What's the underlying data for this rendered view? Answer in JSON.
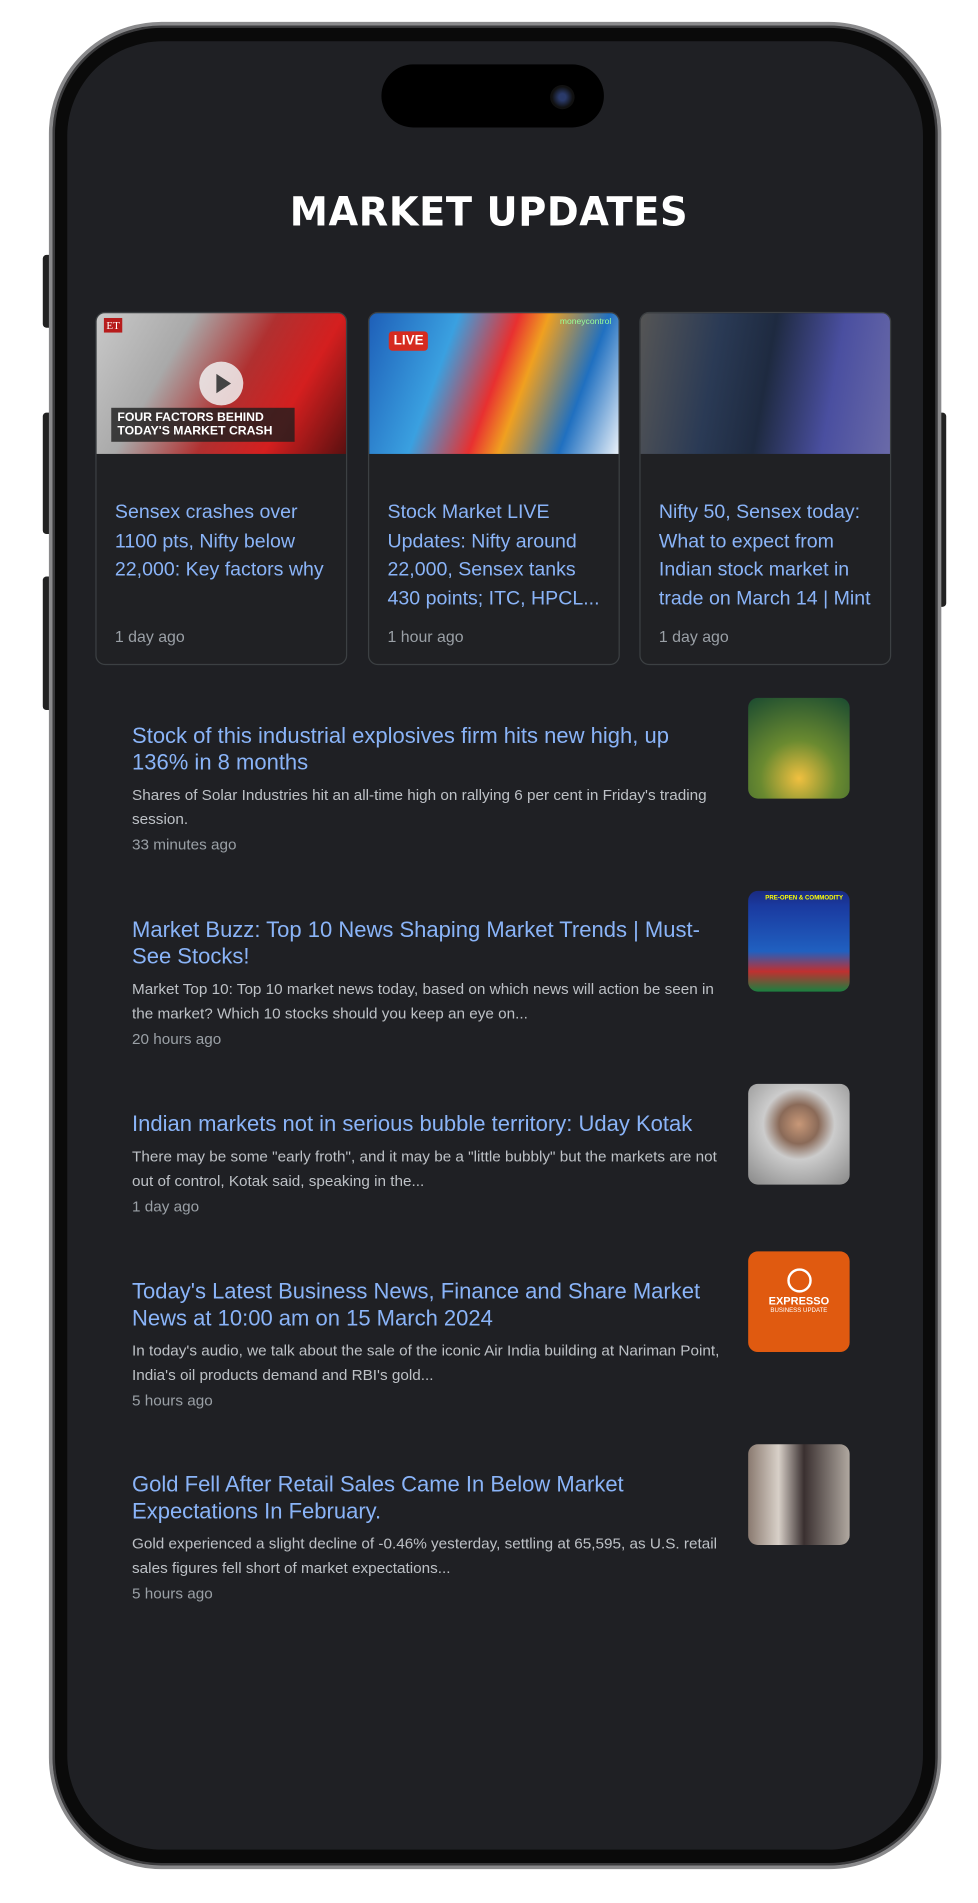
{
  "header": {
    "title": "MARKET UPDATES"
  },
  "top_stories": [
    {
      "title": "Sensex crashes over 1100 pts, Nifty below 22,000: Key factors why",
      "time": "1 day ago",
      "image_text": "FOUR FACTORS BEHIND TODAY'S MARKET CRASH",
      "image_logo": "ET"
    },
    {
      "title": "Stock Market LIVE Updates: Nifty around 22,000, Sensex tanks 430 points; ITC, HPCL...",
      "time": "1 hour ago",
      "badge": "LIVE",
      "image_logo": "moneycontrol"
    },
    {
      "title": "Nifty 50, Sensex today: What to expect from Indian stock market in trade on March 14 | Mint",
      "time": "1 day ago"
    }
  ],
  "articles": [
    {
      "title": "Stock of this industrial explosives firm hits new high, up 136% in 8 months",
      "snippet": "Shares of Solar Industries hit an all-time high on rallying 6 per cent in Friday's trading session.",
      "time": "33 minutes ago"
    },
    {
      "title": "Market Buzz: Top 10 News Shaping Market Trends | Must-See Stocks!",
      "snippet": "Market Top 10: Top 10 market news today, based on which news will action be seen in the market? Which 10 stocks should you keep an eye on...",
      "time": "20 hours ago",
      "image_text": "PRE-OPEN & COMMODITY"
    },
    {
      "title": "Indian markets not in serious bubble territory: Uday Kotak",
      "snippet": "There may be some \"early froth\", and it may be a \"little bubbly\" but the markets are not out of control, Kotak said, speaking in the...",
      "time": "1 day ago"
    },
    {
      "title": "Today's Latest Business News, Finance and Share Market News at 10:00 am on 15 March 2024",
      "snippet": "In today's audio, we talk about the sale of the iconic Air India building at Nariman Point, India's oil products demand and RBI's gold...",
      "time": "5 hours ago",
      "image_text": "EXPRESSO",
      "image_subtext": "BUSINESS UPDATE"
    },
    {
      "title": "Gold Fell After Retail Sales Came In Below Market Expectations In February.",
      "snippet": "Gold experienced a slight decline of -0.46% yesterday, settling at 65,595, as U.S. retail sales figures fell short of market expectations...",
      "time": "5 hours ago"
    }
  ],
  "colors": {
    "background": "#1f2024",
    "link": "#8ab4f8",
    "snippet": "#bdc1c6",
    "time": "#9aa0a6",
    "title": "#ffffff"
  }
}
